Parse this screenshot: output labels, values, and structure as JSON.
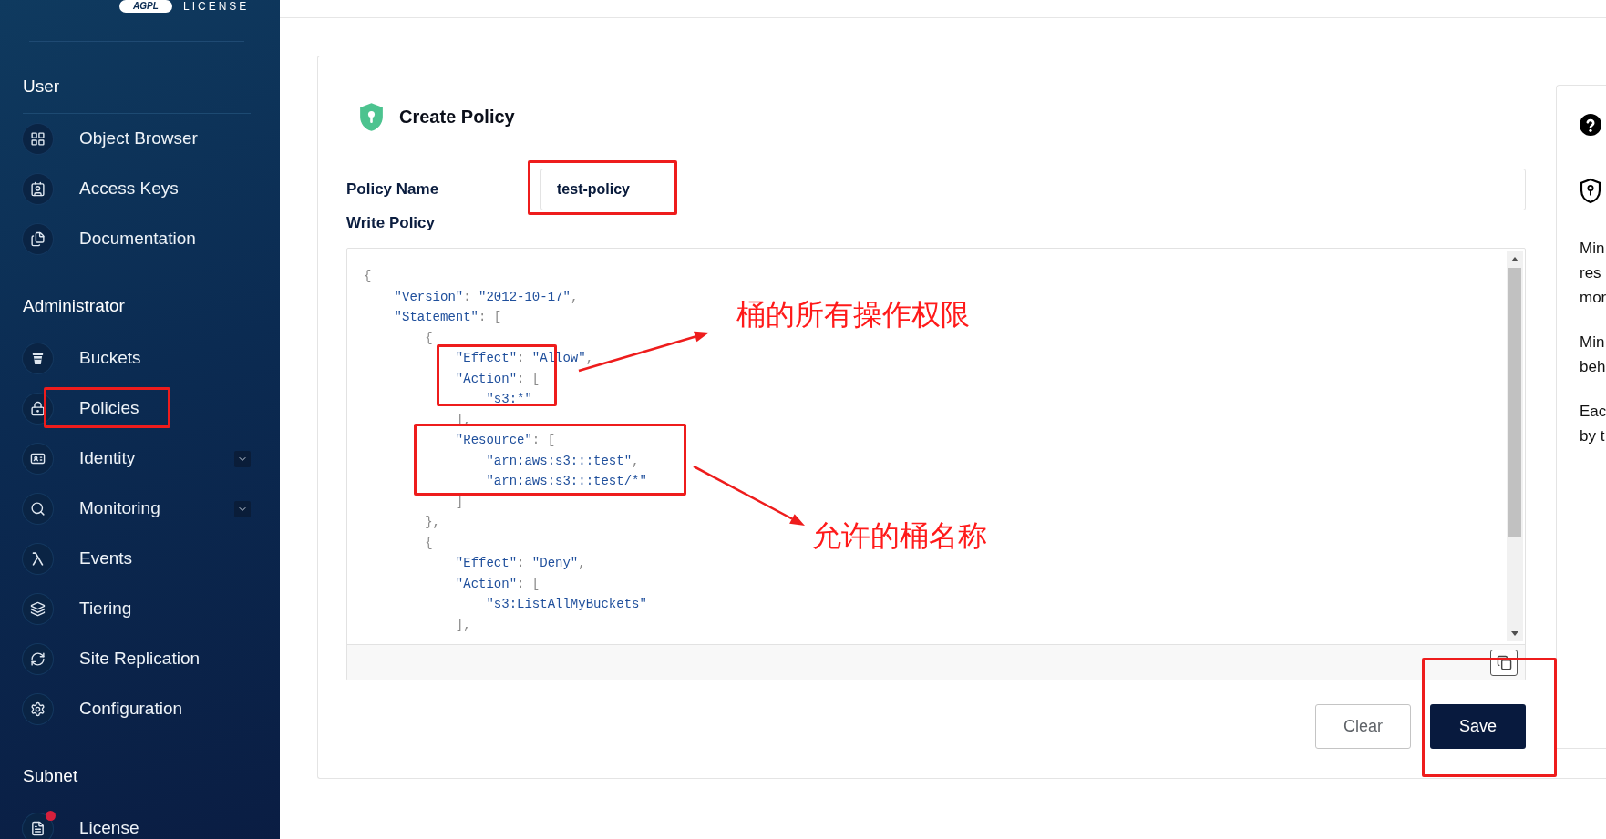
{
  "sidebar": {
    "logo_text": "AGPL",
    "logo_caption": "LICENSE",
    "sections": [
      {
        "title": "User",
        "items": [
          {
            "label": "Object Browser",
            "kind": "link",
            "notification": false
          },
          {
            "label": "Access Keys",
            "kind": "link",
            "notification": false
          },
          {
            "label": "Documentation",
            "kind": "link",
            "notification": false
          }
        ]
      },
      {
        "title": "Administrator",
        "items": [
          {
            "label": "Buckets",
            "kind": "link",
            "notification": false
          },
          {
            "label": "Policies",
            "kind": "link",
            "notification": false
          },
          {
            "label": "Identity",
            "kind": "group",
            "expanded": false,
            "notification": false
          },
          {
            "label": "Monitoring",
            "kind": "group",
            "expanded": false,
            "notification": false
          },
          {
            "label": "Events",
            "kind": "link",
            "notification": false
          },
          {
            "label": "Tiering",
            "kind": "link",
            "notification": false
          },
          {
            "label": "Site Replication",
            "kind": "link",
            "notification": false
          },
          {
            "label": "Configuration",
            "kind": "link",
            "notification": false
          }
        ]
      },
      {
        "title": "Subnet",
        "items": [
          {
            "label": "License",
            "kind": "link",
            "notification": true
          }
        ]
      }
    ]
  },
  "policy_form": {
    "title": "Create Policy",
    "name_label": "Policy Name",
    "name_value": "test-policy",
    "editor_label": "Write Policy",
    "code_lines": [
      "{",
      "    \"Version\": \"2012-10-17\",",
      "    \"Statement\": [",
      "        {",
      "            \"Effect\": \"Allow\",",
      "            \"Action\": [",
      "                \"s3:*\"",
      "            ],",
      "            \"Resource\": [",
      "                \"arn:aws:s3:::test\",",
      "                \"arn:aws:s3:::test/*\"",
      "            ]",
      "        },",
      "        {",
      "            \"Effect\": \"Deny\",",
      "            \"Action\": [",
      "                \"s3:ListAllMyBuckets\"",
      "            ],"
    ],
    "buttons": [
      {
        "label": "Clear",
        "kind": "secondary"
      },
      {
        "label": "Save",
        "kind": "primary"
      }
    ]
  },
  "help_panel": {
    "paragraphs": [
      [
        "Min",
        "res",
        "mor"
      ],
      [
        "Min",
        "beh"
      ],
      [
        "Eac",
        "by t"
      ]
    ]
  },
  "annotations": [
    "桶的所有操作权限",
    "允许的桶名称"
  ]
}
